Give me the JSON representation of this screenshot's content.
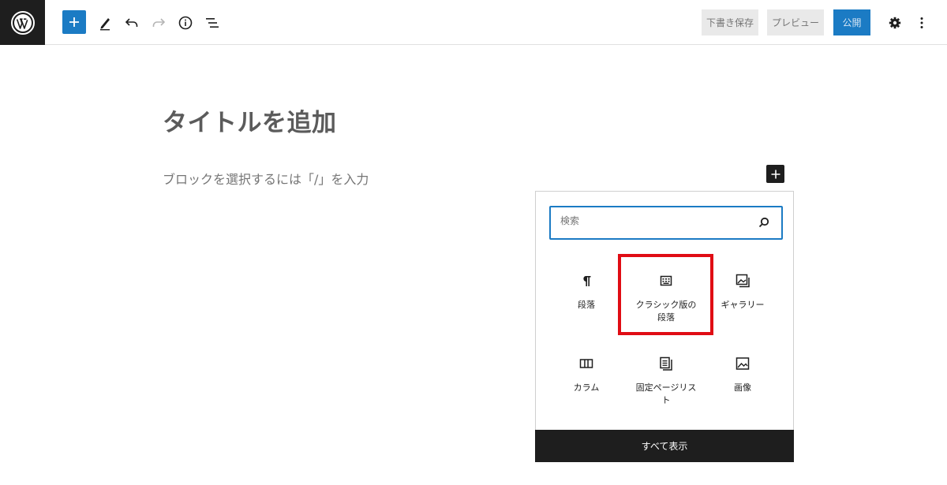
{
  "toolbar": {
    "add_block_label": "+",
    "save_draft_label": "下書き保存",
    "preview_label": "プレビュー",
    "publish_label": "公開"
  },
  "editor": {
    "title_placeholder": "タイトルを追加",
    "block_placeholder": "ブロックを選択するには「/」を入力"
  },
  "inserter": {
    "search_placeholder": "検索",
    "blocks": [
      {
        "label": "段落",
        "icon": "paragraph-icon"
      },
      {
        "label": "クラシック版の段落",
        "icon": "classic-icon"
      },
      {
        "label": "ギャラリー",
        "icon": "gallery-icon"
      },
      {
        "label": "カラム",
        "icon": "columns-icon"
      },
      {
        "label": "固定ページリスト",
        "icon": "page-list-icon"
      },
      {
        "label": "画像",
        "icon": "image-icon"
      }
    ],
    "show_all_label": "すべて表示"
  },
  "colors": {
    "accent": "#1b7bc4",
    "highlight": "#e00c14",
    "dark": "#1e1e1e"
  }
}
